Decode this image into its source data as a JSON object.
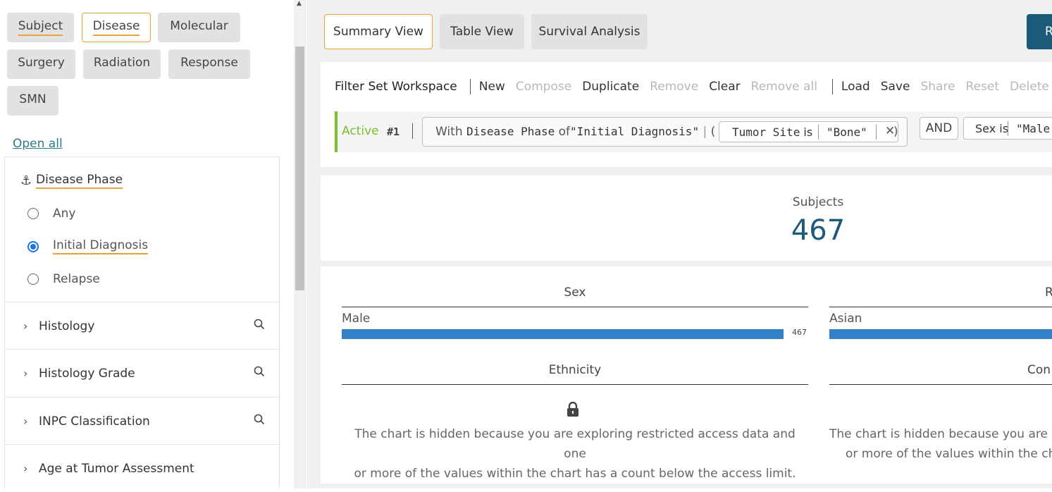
{
  "left_panel": {
    "tabs": [
      "Subject",
      "Disease",
      "Molecular",
      "Surgery",
      "Radiation",
      "Response",
      "SMN"
    ],
    "active_tab": "Disease",
    "open_all": "Open all",
    "disease_phase": {
      "title": "Disease Phase",
      "options": [
        "Any",
        "Initial Diagnosis",
        "Relapse"
      ],
      "selected": "Initial Diagnosis"
    },
    "facets": [
      "Histology",
      "Histology Grade",
      "INPC Classification",
      "Age at Tumor Assessment"
    ]
  },
  "view_tabs": [
    "Summary View",
    "Table View",
    "Survival Analysis"
  ],
  "active_view": "Summary View",
  "right_button": "R",
  "workspace": {
    "title": "Filter Set Workspace",
    "actions_group1": [
      {
        "label": "New",
        "enabled": true
      },
      {
        "label": "Compose",
        "enabled": false
      },
      {
        "label": "Duplicate",
        "enabled": true
      },
      {
        "label": "Remove",
        "enabled": false
      },
      {
        "label": "Clear",
        "enabled": true
      },
      {
        "label": "Remove all",
        "enabled": false
      }
    ],
    "actions_group2": [
      {
        "label": "Load",
        "enabled": true
      },
      {
        "label": "Save",
        "enabled": true
      },
      {
        "label": "Share",
        "enabled": false
      },
      {
        "label": "Reset",
        "enabled": false
      },
      {
        "label": "Delete",
        "enabled": false
      }
    ],
    "active_label": "Active",
    "filter_index": "#1",
    "filter": {
      "with": "With",
      "phase_field": "Disease Phase",
      "of": "of",
      "phase_value": "\"Initial Diagnosis\"",
      "open_paren": "(",
      "close_paren": ")",
      "site_field": "Tumor Site",
      "is": "is",
      "site_value": "\"Bone\"",
      "and": "AND",
      "sex_field": "Sex",
      "sex_value": "\"Male"
    }
  },
  "summary": {
    "subjects_label": "Subjects",
    "subjects_count": "467"
  },
  "charts": {
    "sex": {
      "title": "Sex",
      "category": "Male",
      "value": 467,
      "value_label": "467"
    },
    "race": {
      "title": "R",
      "category": "Asian"
    },
    "ethnicity": {
      "title": "Ethnicity"
    },
    "consent": {
      "title": "Con"
    },
    "hidden_message_line1": "The chart is hidden because you are exploring restricted access data and one",
    "hidden_message_line2": "or more of the values within the chart has a count below the access limit.",
    "hidden_message_right_line1": "The chart is hidden because you are e",
    "hidden_message_right_line2": "or more of the values within the ch"
  },
  "colors": {
    "accent_underline": "#e6a23c",
    "active_green": "#78c02a",
    "bar_blue": "#3380c8",
    "count_teal": "#1c5a7a"
  }
}
